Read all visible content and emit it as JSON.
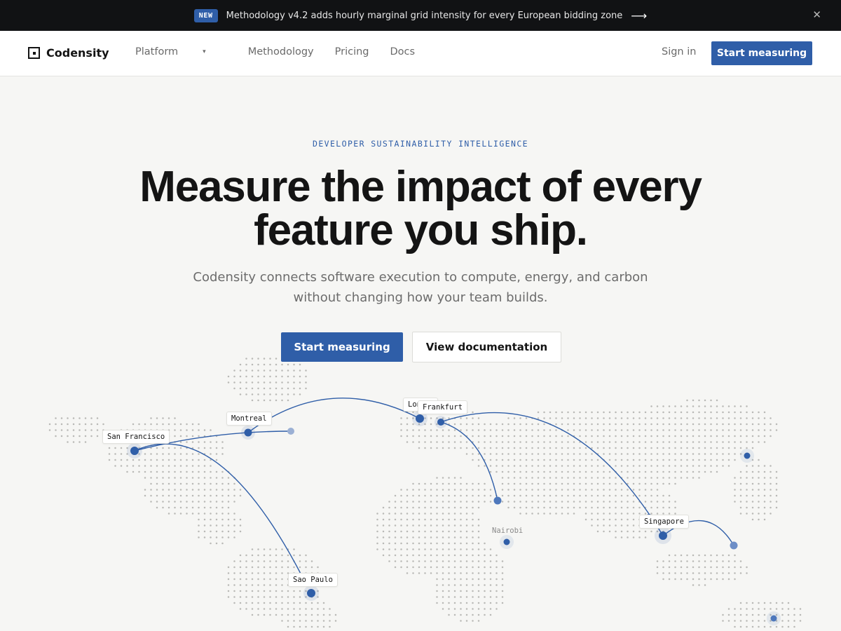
{
  "announcement": {
    "badge": "NEW",
    "text": "Methodology v4.2 adds hourly marginal grid intensity for every European bidding zone",
    "arrow": "⟶",
    "close": "✕"
  },
  "nav": {
    "brand": "Codensity",
    "links": [
      "Platform",
      "Methodology",
      "Pricing",
      "Docs"
    ],
    "platform_caret": "▾",
    "signin": "Sign in",
    "cta": "Start measuring"
  },
  "hero": {
    "eyebrow": "DEVELOPER SUSTAINABILITY INTELLIGENCE",
    "headline_line1": "Measure the impact of every",
    "headline_line2": "feature you ship.",
    "subtitle_line1": "Codensity connects software execution to compute, energy, and carbon",
    "subtitle_line2": "without changing how your team builds.",
    "primary_button": "Start measuring",
    "secondary_button": "View documentation"
  },
  "map": {
    "cities": [
      "San Francisco",
      "Montreal",
      "London",
      "Frankfurt",
      "Nairobi",
      "Singapore",
      "Sao Paulo"
    ],
    "colors": {
      "accent": "#2f5ea8",
      "dots": "#b9b9b6"
    }
  }
}
